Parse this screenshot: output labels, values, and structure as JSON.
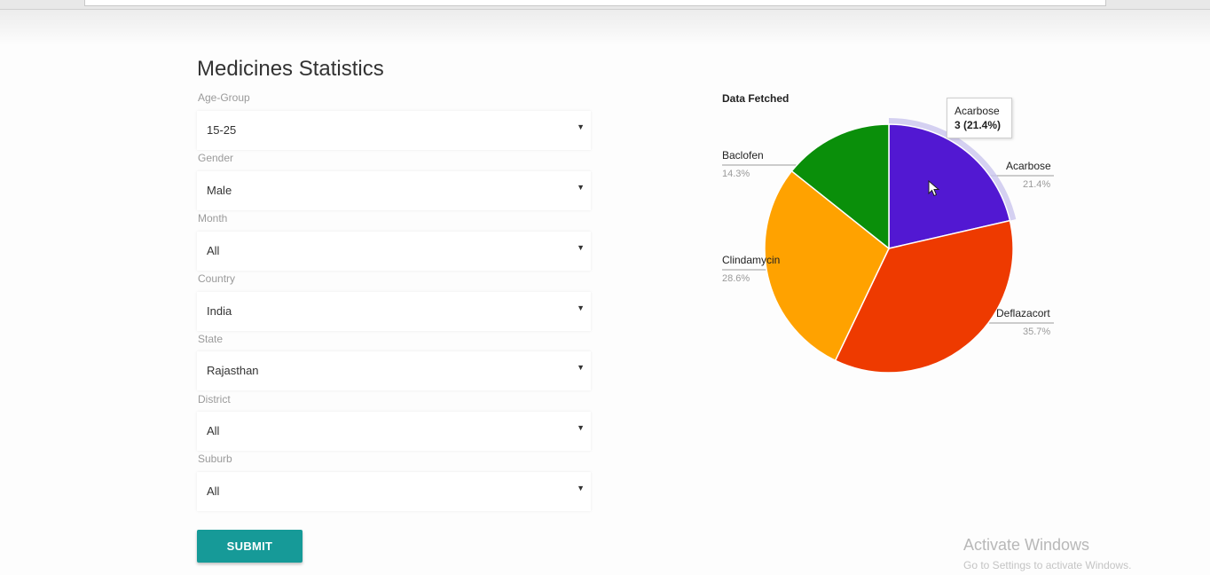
{
  "page": {
    "title": "Medicines Statistics"
  },
  "form": {
    "fields": [
      {
        "label": "Age-Group",
        "value": "15-25"
      },
      {
        "label": "Gender",
        "value": "Male"
      },
      {
        "label": "Month",
        "value": "All"
      },
      {
        "label": "Country",
        "value": "India"
      },
      {
        "label": "State",
        "value": "Rajasthan"
      },
      {
        "label": "District",
        "value": "All"
      },
      {
        "label": "Suburb",
        "value": "All"
      }
    ],
    "submit_label": "SUBMIT",
    "caret_glyph": "▼"
  },
  "chart_data": {
    "type": "pie",
    "title": "Data Fetched",
    "slices": [
      {
        "name": "Acarbose",
        "count": 3,
        "percent": "21.4%",
        "color": "#5218d2"
      },
      {
        "name": "Deflazacort",
        "percent": "35.7%",
        "color": "#ee3a00"
      },
      {
        "name": "Clindamycin",
        "percent": "28.6%",
        "color": "#ffa200"
      },
      {
        "name": "Baclofen",
        "percent": "14.3%",
        "color": "#0a8f0a"
      }
    ],
    "tooltip": {
      "name": "Acarbose",
      "value": "3 (21.4%)"
    },
    "highlighted_slice": "Acarbose"
  },
  "watermark": {
    "title": "Activate Windows",
    "subtitle": "Go to Settings to activate Windows."
  }
}
